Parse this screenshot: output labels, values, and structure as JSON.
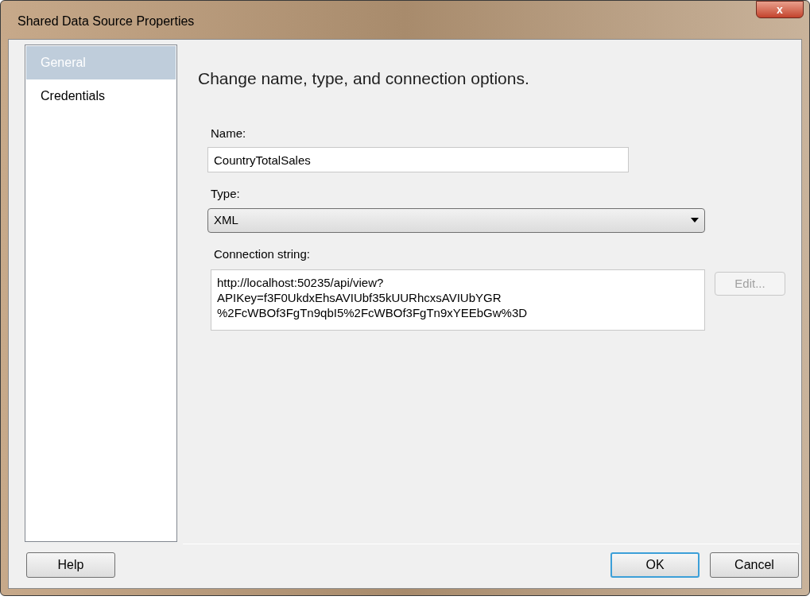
{
  "window": {
    "title": "Shared Data Source Properties",
    "close": "x"
  },
  "sidebar": {
    "items": [
      {
        "label": "General",
        "selected": true
      },
      {
        "label": "Credentials",
        "selected": false
      }
    ]
  },
  "heading": "Change name, type, and connection options.",
  "name_field": {
    "label": "Name:",
    "value": "CountryTotalSales"
  },
  "type_field": {
    "label": "Type:",
    "value": "XML"
  },
  "connection": {
    "label": "Connection string:",
    "lines": [
      "http://localhost:50235/api/view?",
      "APIKey=f3F0UkdxEhsAVIUbf35kUURhcxsAVIUbYGR",
      "%2FcWBOf3FgTn9qbI5%2FcWBOf3FgTn9xYEEbGw%3D"
    ],
    "edit_button": {
      "label": "Edit...",
      "disabled": true
    }
  },
  "buttons": [
    {
      "label": "Help",
      "default": false
    },
    {
      "label": "OK",
      "default": true
    },
    {
      "label": "Cancel",
      "default": false
    }
  ]
}
